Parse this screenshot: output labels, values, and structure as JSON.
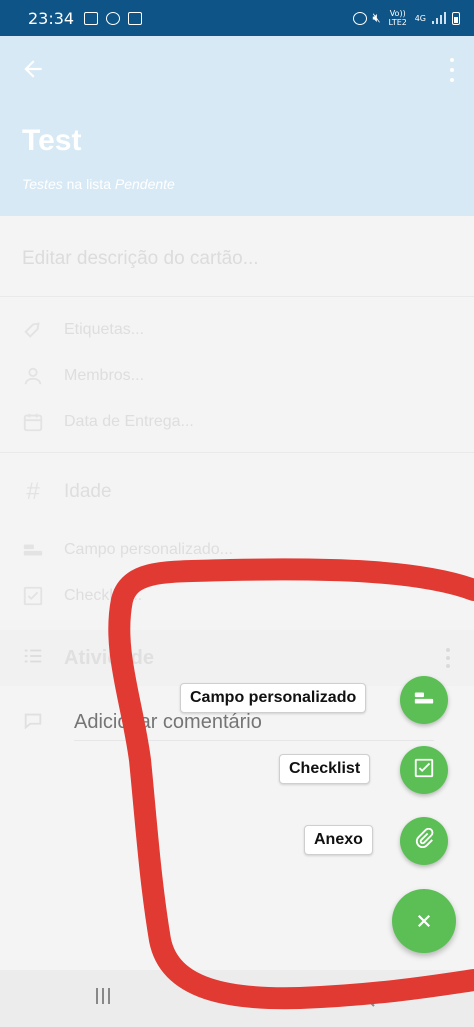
{
  "status_bar": {
    "time": "23:34",
    "network_label": "4G",
    "volte_label": "Vo)) LTE2"
  },
  "header": {
    "title": "Test",
    "board_name": "Testes",
    "in_list_text": " na lista ",
    "list_name": "Pendente"
  },
  "description_placeholder": "Editar descrição do cartão...",
  "rows": {
    "labels": "Etiquetas...",
    "members": "Membros...",
    "due_date": "Data de Entrega...",
    "age": "Idade",
    "custom_field": "Campo personalizado...",
    "checklist": "Checklist..."
  },
  "activity": {
    "label": "Atividade"
  },
  "comment": {
    "placeholder": "Adicionar comentário"
  },
  "fab_menu": {
    "custom_field": "Campo personalizado",
    "checklist": "Checklist",
    "attachment": "Anexo"
  },
  "colors": {
    "status_bar": "#0f5486",
    "header": "#d7e9f5",
    "fab": "#5bbf55",
    "annotation": "#e03a33"
  }
}
